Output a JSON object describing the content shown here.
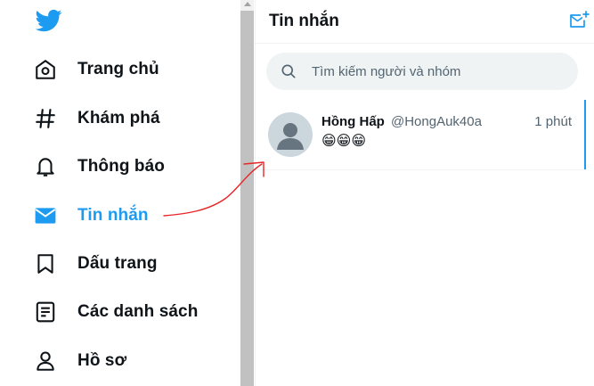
{
  "sidebar": {
    "items": [
      {
        "label": "Trang chủ",
        "icon": "home-icon"
      },
      {
        "label": "Khám phá",
        "icon": "hashtag-icon"
      },
      {
        "label": "Thông báo",
        "icon": "bell-icon"
      },
      {
        "label": "Tin nhắn",
        "icon": "mail-icon",
        "active": true
      },
      {
        "label": "Dấu trang",
        "icon": "bookmark-icon"
      },
      {
        "label": "Các danh sách",
        "icon": "list-icon"
      },
      {
        "label": "Hồ sơ",
        "icon": "profile-icon"
      }
    ]
  },
  "messages": {
    "title": "Tin nhắn",
    "search_placeholder": "Tìm kiếm người và nhóm",
    "conversations": [
      {
        "name": "Hồng Hấp",
        "handle": "@HongAuk40a",
        "time": "1 phút",
        "preview": "😁😁😁"
      }
    ]
  },
  "colors": {
    "accent": "#1d9bf0",
    "text": "#0f1419",
    "secondary": "#536471",
    "annotation": "#e8262a"
  }
}
